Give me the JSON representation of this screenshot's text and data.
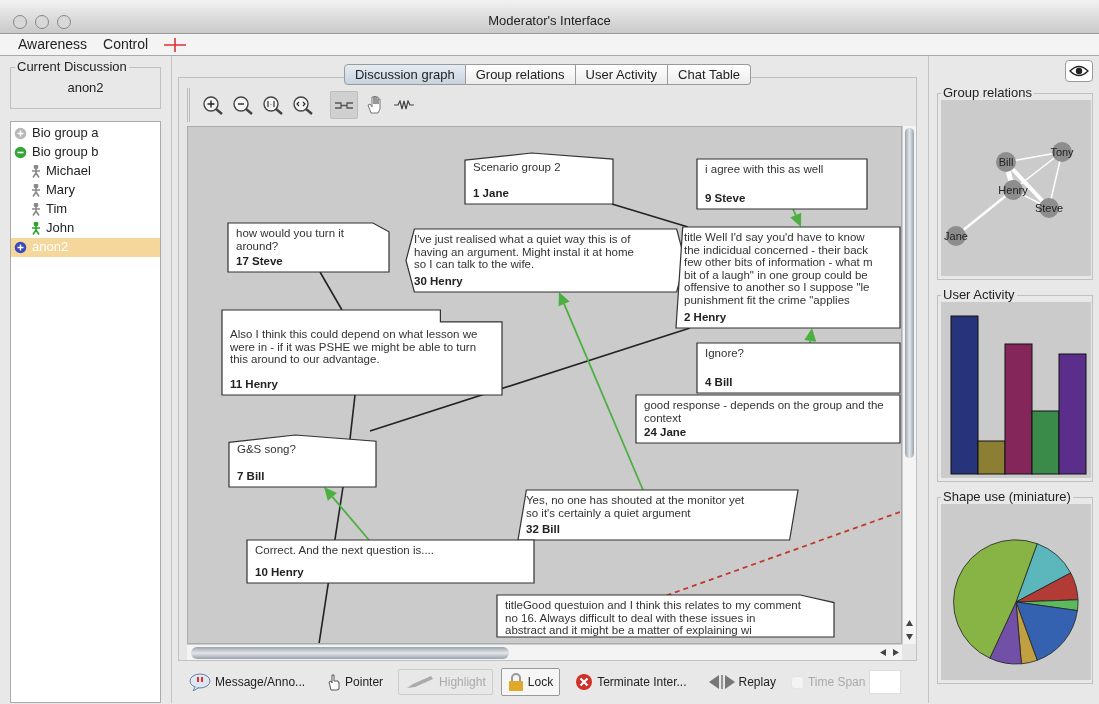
{
  "window": {
    "title": "Moderator's Interface"
  },
  "menu": [
    {
      "label": "Awareness"
    },
    {
      "label": "Control"
    }
  ],
  "current_discussion": {
    "title": "Current Discussion",
    "value": "anon2"
  },
  "tree": [
    {
      "label": "Bio group a",
      "kind": "group",
      "expanded": false,
      "selected": false
    },
    {
      "label": "Bio group b",
      "kind": "group",
      "expanded": true,
      "selected": false,
      "children": [
        {
          "label": "Michael",
          "kind": "user",
          "online": false,
          "selected": false
        },
        {
          "label": "Mary",
          "kind": "user",
          "online": false,
          "selected": false
        },
        {
          "label": "Tim",
          "kind": "user",
          "online": false,
          "selected": false
        },
        {
          "label": "John",
          "kind": "user",
          "online": true,
          "selected": false
        }
      ]
    },
    {
      "label": "anon2",
      "kind": "discussion",
      "expanded": false,
      "selected": true
    }
  ],
  "tabs": [
    {
      "label": "Discussion graph",
      "selected": true
    },
    {
      "label": "Group relations",
      "selected": false
    },
    {
      "label": "User Activity",
      "selected": false
    },
    {
      "label": "Chat Table",
      "selected": false
    }
  ],
  "graph_tools": [
    {
      "selected": false
    },
    {
      "selected": false
    },
    {
      "selected": false
    },
    {
      "selected": false
    },
    {
      "selected": true
    },
    {
      "selected": false
    },
    {
      "selected": false
    }
  ],
  "nodes": [
    {
      "kind": "pentagon",
      "lines": [
        "Scenario group 2"
      ],
      "author": "1 Jane"
    },
    {
      "kind": "rect",
      "lines": [
        "i agree with this as well"
      ],
      "author": "9 Steve"
    },
    {
      "kind": "cut-corner",
      "lines": [
        "how would you turn it",
        "around?"
      ],
      "author": "17 Steve"
    },
    {
      "kind": "hexagon",
      "lines": [
        "I've just realised what a quiet way this is of",
        "having an argument.  Might instal it at home",
        "so I can talk to the wife."
      ],
      "author": "30 Henry"
    },
    {
      "kind": "slant",
      "lines": [
        "title Well I'd say you'd have to know",
        "the indicidual concerned - their back",
        "few other bits of information - what m",
        "bit of a laugh\" in one group could be",
        "offensive to another so I suppose \"le",
        "punishment fit the crime \"applies"
      ],
      "author": "2 Henry"
    },
    {
      "kind": "notch",
      "lines": [
        "Also I think this could depend on what lesson we",
        "were in - if it was PSHE we might be able to turn",
        "this around to our advantage."
      ],
      "author": "11 Henry"
    },
    {
      "kind": "rect",
      "lines": [
        "Ignore?"
      ],
      "author": "4 Bill"
    },
    {
      "kind": "rect",
      "lines": [
        "good response - depends on the group and the",
        "context"
      ],
      "author": "24 Jane"
    },
    {
      "kind": "pentagon",
      "lines": [
        "G&S song?"
      ],
      "author": "7 Bill"
    },
    {
      "kind": "parallelogram",
      "lines": [
        "Yes, no one has shouted at the monitor yet",
        "so it's certainly a quiet argument"
      ],
      "author": "32 Bill"
    },
    {
      "kind": "rect",
      "lines": [
        "Correct.  And the next question is...."
      ],
      "author": "10 Henry"
    },
    {
      "kind": "cut-corner",
      "lines": [
        "titleGood questuion and I think this relates to my comment",
        "no 16.  Always difficult to deal with these issues in",
        "abstract and it might be a matter of explaining wi"
      ]
    }
  ],
  "actions": [
    {
      "label": "Message/Anno...",
      "disabled": false,
      "selected": false
    },
    {
      "label": "Pointer",
      "disabled": false,
      "selected": false
    },
    {
      "label": "Highlight",
      "disabled": true,
      "selected": false
    },
    {
      "label": "Lock",
      "disabled": false,
      "selected": true
    },
    {
      "label": "Terminate Inter...",
      "disabled": false,
      "selected": false
    },
    {
      "label": "Replay",
      "disabled": false,
      "selected": false
    }
  ],
  "time_span": {
    "label": "Time Span",
    "checked": false,
    "disabled": true
  },
  "group_relations": {
    "title": "Group relations",
    "people": [
      {
        "name": "Bill"
      },
      {
        "name": "Tony"
      },
      {
        "name": "Henry"
      },
      {
        "name": "Steve"
      },
      {
        "name": "Jane"
      }
    ]
  },
  "user_activity": {
    "title": "User Activity"
  },
  "shape_use": {
    "title": "Shape use (miniature)"
  }
}
